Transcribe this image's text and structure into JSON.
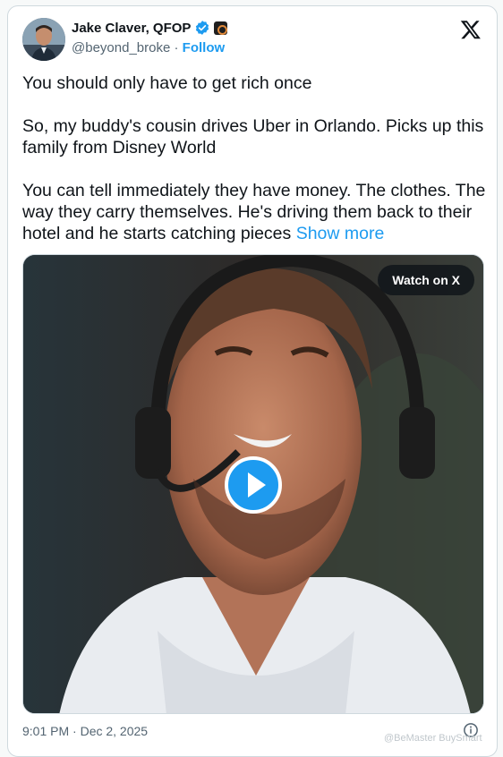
{
  "author": {
    "name": "Jake Claver, QFOP",
    "handle": "@beyond_broke",
    "follow_label": "Follow",
    "separator": "·",
    "avatar_icon": "profile-photo",
    "verified_icon": "verified-badge-icon",
    "affiliate_icon": "affiliate-badge-icon"
  },
  "close_icon": "x-logo-icon",
  "tweet": {
    "line1": "You should only have to get rich once",
    "line2": "So, my buddy's cousin drives Uber in Orlando. Picks up this family from Disney World",
    "line3": "You can tell immediately they have money. The clothes. The way they carry themselves. He's driving them back to their hotel and he starts catching pieces",
    "show_more": "Show more"
  },
  "media": {
    "watch_label": "Watch on X",
    "play_icon": "play-icon"
  },
  "footer": {
    "timestamp": "9:01 PM · Dec 2, 2025",
    "info_icon": "info-icon",
    "watermark": "@BeMaster BuySmart"
  },
  "colors": {
    "link": "#1d9bf0",
    "secondary_text": "#536471",
    "border": "#cfd9de"
  }
}
